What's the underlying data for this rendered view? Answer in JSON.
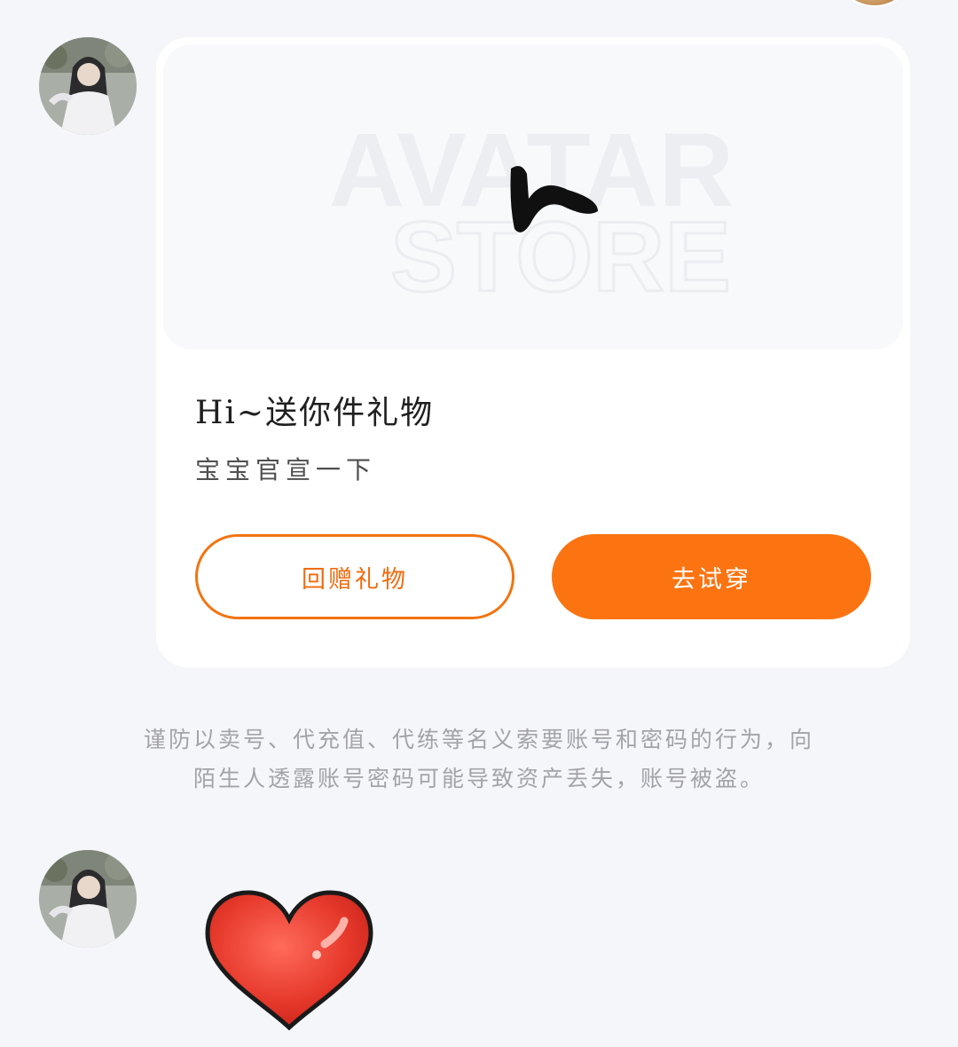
{
  "conversation": {
    "gift_card": {
      "preview_watermark": {
        "line1": "AVATAR",
        "line2": "STORE"
      },
      "item_icon": "black-hair-clip-icon",
      "title": "Hi~送你件礼物",
      "subtitle": "宝宝官宣一下",
      "return_gift_label": "回赠礼物",
      "try_on_label": "去试穿"
    },
    "security_notice": {
      "line1": "谨防以卖号、代充值、代练等名义索要账号和密码的行为，向",
      "line2": "陌生人透露账号密码可能导致资产丢失，账号被盗。"
    },
    "sticker": {
      "icon": "red-heart-icon"
    }
  },
  "colors": {
    "accent": "#fb7411",
    "background": "#f4f6fa",
    "card": "#ffffff",
    "notice_text": "#a3a3a8"
  }
}
